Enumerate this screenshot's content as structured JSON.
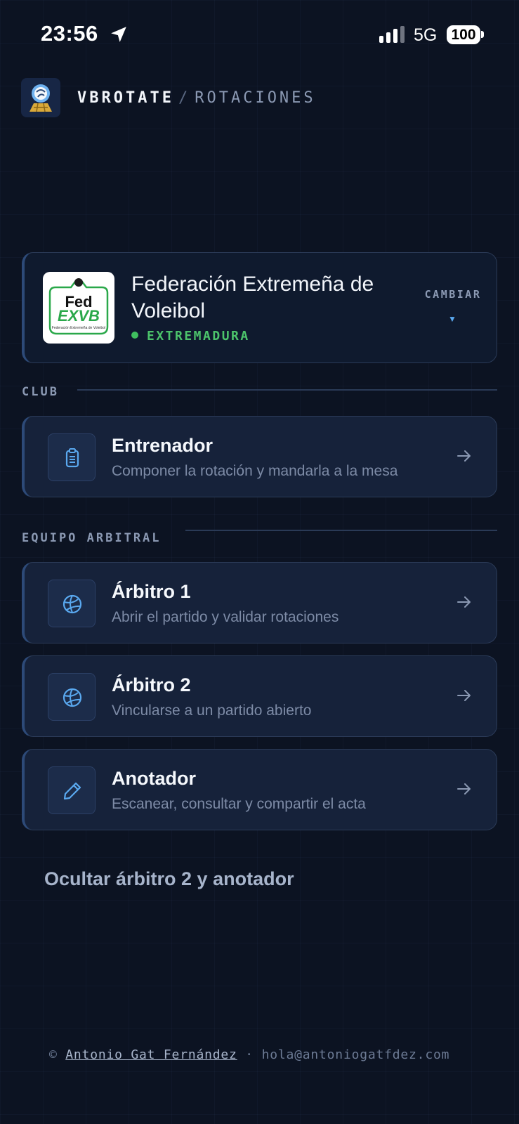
{
  "status_bar": {
    "time": "23:56",
    "network": "5G",
    "battery": "100"
  },
  "header": {
    "brand": "VBROTATE",
    "separator": "/",
    "section": "ROTACIONES"
  },
  "federation": {
    "name": "Federación Extremeña de Voleibol",
    "region": "EXTREMADURA",
    "change_label": "CAMBIAR",
    "logo_text_top": "Fed",
    "logo_text_mid": "EXVB",
    "logo_text_bottom": "Federación Extremeña de Voleibol"
  },
  "sections": {
    "club": "CLUB",
    "equipo_arbitral": "EQUIPO ARBITRAL"
  },
  "roles": [
    {
      "title": "Entrenador",
      "description": "Componer la rotación y mandarla a la mesa",
      "icon": "clipboard-icon"
    },
    {
      "title": "Árbitro 1",
      "description": "Abrir el partido y validar rotaciones",
      "icon": "volleyball-icon"
    },
    {
      "title": "Árbitro 2",
      "description": "Vincularse a un partido abierto",
      "icon": "volleyball-icon"
    },
    {
      "title": "Anotador",
      "description": "Escanear, consultar y compartir el acta",
      "icon": "pencil-icon"
    }
  ],
  "toggle_label": "Ocultar árbitro 2 y anotador",
  "footer": {
    "copyright": "©",
    "author": "Antonio Gat Fernández",
    "separator": "·",
    "email": "hola@antoniogatfdez.com"
  },
  "colors": {
    "background": "#0c1322",
    "card": "#16223a",
    "accent_green": "#3fbf5f",
    "accent_blue": "#5aa9f0",
    "muted_text": "#8b99b3"
  }
}
